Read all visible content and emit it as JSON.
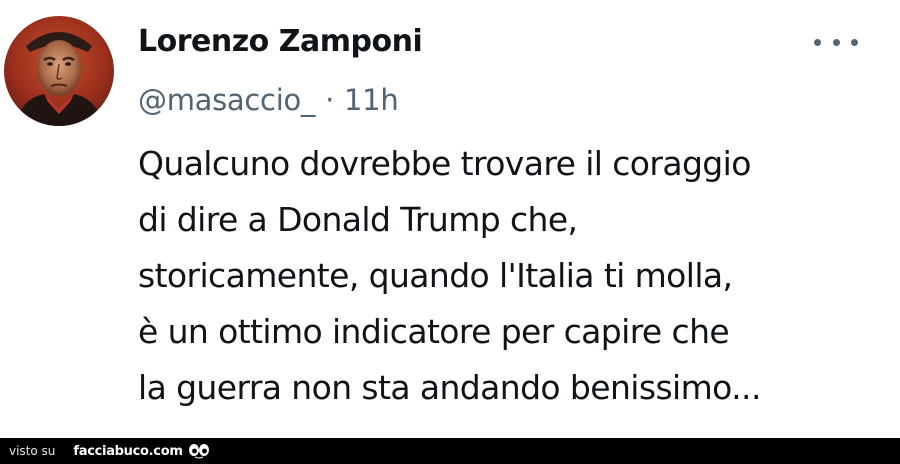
{
  "tweet": {
    "display_name": "Lorenzo Zamponi",
    "handle": "@masaccio_",
    "separator": "·",
    "timestamp": "11h",
    "more_icon": "more-horizontal-icon",
    "avatar_icon": "avatar-portrait-image",
    "text_lines": [
      "Qualcuno dovrebbe trovare il coraggio",
      "di dire a Donald Trump che,",
      "storicamente, quando l'Italia ti molla,",
      "è un ottimo indicatore per capire che",
      "la guerra non sta andando benissimo..."
    ]
  },
  "footer": {
    "prefix": "visto su",
    "site": "facciabuco.com",
    "logo_icon": "facciabuco-eyes-icon",
    "background": "#000000"
  },
  "colors": {
    "name": "#0f1419",
    "secondary": "#536471",
    "body_text": "#0f1419"
  }
}
